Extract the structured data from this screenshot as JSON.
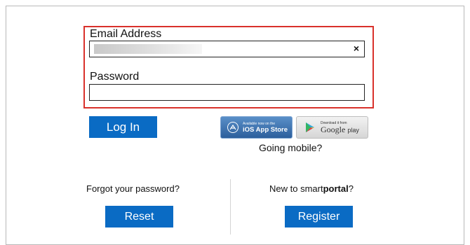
{
  "login": {
    "email_label": "Email Address",
    "clear_symbol": "×",
    "password_label": "Password",
    "login_button": "Log In"
  },
  "mobile": {
    "ios_small": "Available now on the",
    "ios_big": "iOS App Store",
    "gp_small": "Download it from",
    "gp_big": "Google",
    "gp_suffix": "play",
    "going_mobile": "Going mobile?"
  },
  "forgot": {
    "prompt": "Forgot your password?",
    "button": "Reset"
  },
  "register": {
    "prompt_prefix": "New to smart",
    "prompt_bold": "portal",
    "prompt_suffix": "?",
    "button": "Register"
  },
  "colors": {
    "accent": "#0a6bc4",
    "highlight_border": "#d9312b"
  }
}
